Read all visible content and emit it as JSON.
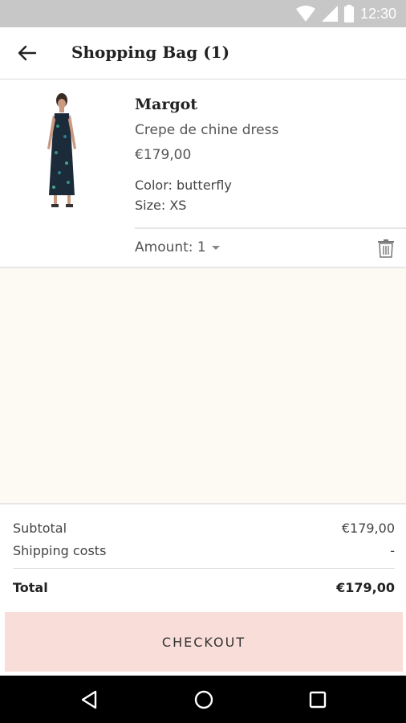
{
  "status_bar": {
    "time": "12:30",
    "icons": [
      "wifi-icon",
      "signal-icon",
      "battery-icon"
    ]
  },
  "app_bar": {
    "title": "Shopping Bag (1)",
    "back_icon": "arrow-left-icon"
  },
  "cart_item": {
    "brand": "Margot",
    "name": "Crepe de chine dress",
    "price": "€179,00",
    "color": "Color: butterfly",
    "size": "Size: XS",
    "amount": "Amount: 1",
    "delete_icon": "trash-icon"
  },
  "summary": {
    "subtotal_label": "Subtotal",
    "subtotal_value": "€179,00",
    "shipping_label": "Shipping costs",
    "shipping_value": "-",
    "total_label": "Total",
    "total_value": "€179,00"
  },
  "checkout": {
    "label": "CHECKOUT"
  },
  "nav": {
    "icons": [
      "back-triangle-icon",
      "home-circle-icon",
      "recents-square-icon"
    ]
  },
  "colors": {
    "status_bar": "#c7c7c7",
    "checkout_bg": "#f9ddd8",
    "empty_area": "#fdf9f3"
  }
}
